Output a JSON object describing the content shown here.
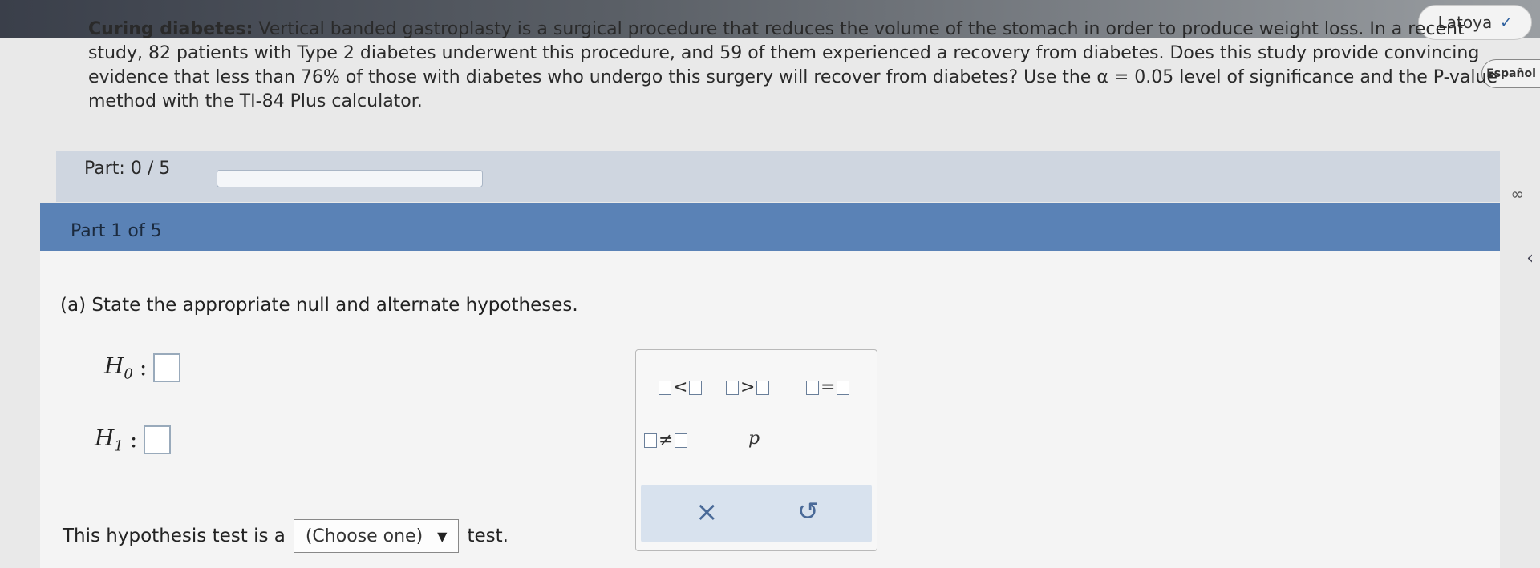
{
  "header": {
    "user_name": "Latoya",
    "language_button": "Español"
  },
  "problem": {
    "title": "Curing diabetes:",
    "text_line1": "Vertical banded gastroplasty is a surgical procedure that reduces the volume of the stomach in order to produce weight loss. In a recent",
    "text_line2": "study, 82 patients with Type 2 diabetes underwent this procedure, and 59 of them experienced a recovery from diabetes. Does this study provide convincing",
    "text_line3": "evidence that less than 76% of those with diabetes who undergo this surgery will recover from diabetes? Use the α = 0.05 level of significance and the P-value",
    "text_line4": "method with the TI-84 Plus calculator."
  },
  "progress": {
    "label": "Part: 0 / 5",
    "fraction": 0.0
  },
  "section": {
    "label": "Part 1 of 5"
  },
  "question": {
    "text": "(a) State the appropriate null and alternate hypotheses.",
    "h0_label": "H",
    "h0_sub": "0",
    "h1_label": "H",
    "h1_sub": "1",
    "colon": ":"
  },
  "palette": {
    "less_than": "<",
    "greater_than": ">",
    "equals": "=",
    "not_equals": "≠",
    "p_symbol": "p",
    "clear_symbol": "×",
    "undo_symbol": "↺"
  },
  "test_type": {
    "prefix": "This hypothesis test is a",
    "select_value": "(Choose one)",
    "suffix": "test."
  }
}
